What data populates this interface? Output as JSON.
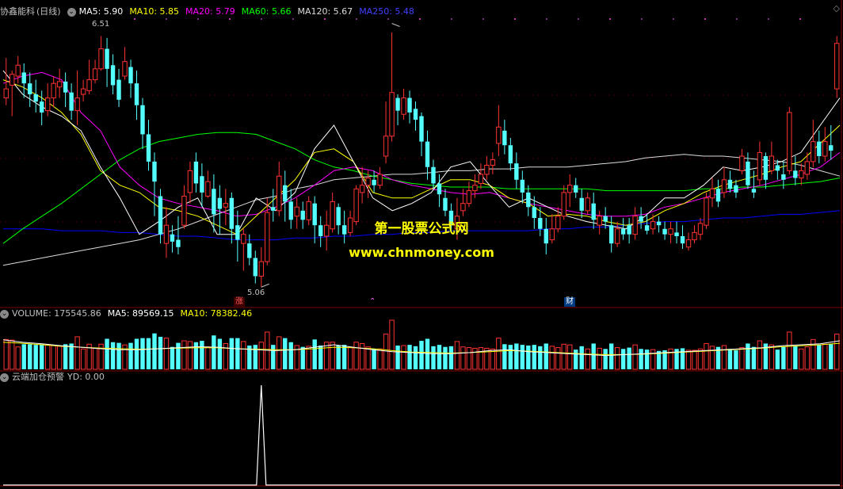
{
  "legend_main": {
    "name": "协鑫能科",
    "period": "(日线)",
    "ma5": "MA5: 5.90",
    "ma10": "MA10: 5.85",
    "ma20": "MA20: 5.79",
    "ma60": "MA60: 5.66",
    "ma120": "MA120: 5.67",
    "ma250": "MA250: 5.48"
  },
  "legend_vol": {
    "volume": "VOLUME: 175545.86",
    "ma5": "MA5: 89569.15",
    "ma10": "MA10: 78382.46"
  },
  "legend_ind": {
    "name": "云端加仓预警",
    "yd": "YD: 0.00"
  },
  "annotations": {
    "high": "6.51",
    "low": "5.06",
    "zhang": "涨",
    "cai": "财"
  },
  "watermark": {
    "line1": "第一股票公式网",
    "line2": "www.chnmoney.com"
  },
  "colors": {
    "up": "#ff3232",
    "down": "#54ffff",
    "ma5": "#ffffff",
    "ma10": "#ffff00",
    "ma20": "#ff00ff",
    "ma60": "#00ff00",
    "ma120": "#dcdcdc",
    "ma250": "#0000ff",
    "signal": "#ffffff",
    "grid": "#7f0000"
  },
  "chart_data": {
    "type": "candlestick",
    "price_range": [
      5.0,
      6.56
    ],
    "high_point": 6.51,
    "low_point": 5.06,
    "candles": [
      [
        6.1,
        6.15,
        6.06,
        6.32
      ],
      [
        6.17,
        6.23,
        6.0,
        6.25
      ],
      [
        6.22,
        6.28,
        6.18,
        6.33
      ],
      [
        6.24,
        6.18,
        6.1,
        6.29
      ],
      [
        6.18,
        6.12,
        6.05,
        6.24
      ],
      [
        6.12,
        6.08,
        6.02,
        6.2
      ],
      [
        6.08,
        6.02,
        5.95,
        6.14
      ],
      [
        6.03,
        6.1,
        6.0,
        6.18
      ],
      [
        6.1,
        6.18,
        6.05,
        6.22
      ],
      [
        6.16,
        6.19,
        6.1,
        6.26
      ],
      [
        6.19,
        6.13,
        6.05,
        6.24
      ],
      [
        6.13,
        6.03,
        5.98,
        6.18
      ],
      [
        6.03,
        6.1,
        5.95,
        6.25
      ],
      [
        6.12,
        6.15,
        6.08,
        6.2
      ],
      [
        6.14,
        6.2,
        6.12,
        6.31
      ],
      [
        6.2,
        6.26,
        6.18,
        6.31
      ],
      [
        6.26,
        6.37,
        6.25,
        6.44
      ],
      [
        6.37,
        6.26,
        6.16,
        6.43
      ],
      [
        6.28,
        6.17,
        6.12,
        6.34
      ],
      [
        6.2,
        6.09,
        6.05,
        6.26
      ],
      [
        6.22,
        6.3,
        6.2,
        6.38
      ],
      [
        6.27,
        6.18,
        6.1,
        6.31
      ],
      [
        6.18,
        6.06,
        5.98,
        6.25
      ],
      [
        6.06,
        5.9,
        5.82,
        6.1
      ],
      [
        5.9,
        5.75,
        5.7,
        5.98
      ],
      [
        5.75,
        5.64,
        5.45,
        5.8
      ],
      [
        5.56,
        5.35,
        5.3,
        5.6
      ],
      [
        5.3,
        5.4,
        5.22,
        5.5
      ],
      [
        5.35,
        5.31,
        5.25,
        5.4
      ],
      [
        5.32,
        5.28,
        5.24,
        5.45
      ],
      [
        5.4,
        5.56,
        5.38,
        5.62
      ],
      [
        5.58,
        5.7,
        5.52,
        5.75
      ],
      [
        5.75,
        5.63,
        5.58,
        5.8
      ],
      [
        5.67,
        5.58,
        5.5,
        5.74
      ],
      [
        5.56,
        5.64,
        5.55,
        5.7
      ],
      [
        5.6,
        5.46,
        5.36,
        5.68
      ],
      [
        5.55,
        5.49,
        5.35,
        5.62
      ],
      [
        5.5,
        5.52,
        5.4,
        5.6
      ],
      [
        5.55,
        5.38,
        5.3,
        5.58
      ],
      [
        5.4,
        5.32,
        5.2,
        5.48
      ],
      [
        5.3,
        5.35,
        5.15,
        5.38
      ],
      [
        5.3,
        5.22,
        5.18,
        5.35
      ],
      [
        5.22,
        5.12,
        5.08,
        5.26
      ],
      [
        5.12,
        5.2,
        5.06,
        5.28
      ],
      [
        5.2,
        5.47,
        5.18,
        5.55
      ],
      [
        5.5,
        5.48,
        5.42,
        5.6
      ],
      [
        5.48,
        5.67,
        5.45,
        5.75
      ],
      [
        5.62,
        5.53,
        5.42,
        5.7
      ],
      [
        5.53,
        5.43,
        5.38,
        5.6
      ],
      [
        5.45,
        5.5,
        5.38,
        5.55
      ],
      [
        5.48,
        5.43,
        5.38,
        5.53
      ],
      [
        5.43,
        5.53,
        5.4,
        5.56
      ],
      [
        5.52,
        5.4,
        5.3,
        5.56
      ],
      [
        5.4,
        5.34,
        5.28,
        5.45
      ],
      [
        5.34,
        5.4,
        5.26,
        5.48
      ],
      [
        5.38,
        5.53,
        5.36,
        5.58
      ],
      [
        5.5,
        5.4,
        5.35,
        5.52
      ],
      [
        5.4,
        5.35,
        5.3,
        5.48
      ],
      [
        5.36,
        5.44,
        5.34,
        5.48
      ],
      [
        5.42,
        5.6,
        5.4,
        5.62
      ],
      [
        5.58,
        5.62,
        5.52,
        5.72
      ],
      [
        5.62,
        5.66,
        5.55,
        5.7
      ],
      [
        5.65,
        5.62,
        5.58,
        5.7
      ],
      [
        5.62,
        5.68,
        5.6,
        5.72
      ],
      [
        5.78,
        5.89,
        5.74,
        6.08
      ],
      [
        5.89,
        6.13,
        5.86,
        6.46
      ],
      [
        6.1,
        6.03,
        5.95,
        6.12
      ],
      [
        6.01,
        6.1,
        5.98,
        6.15
      ],
      [
        6.1,
        6.02,
        5.96,
        6.14
      ],
      [
        6.04,
        5.98,
        5.92,
        6.08
      ],
      [
        6.0,
        5.86,
        5.78,
        6.02
      ],
      [
        5.86,
        5.72,
        5.65,
        5.92
      ],
      [
        5.72,
        5.63,
        5.6,
        5.76
      ],
      [
        5.63,
        5.57,
        5.5,
        5.68
      ],
      [
        5.55,
        5.48,
        5.45,
        5.6
      ],
      [
        5.48,
        5.4,
        5.36,
        5.52
      ],
      [
        5.38,
        5.45,
        5.32,
        5.55
      ],
      [
        5.48,
        5.52,
        5.45,
        5.6
      ],
      [
        5.52,
        5.59,
        5.5,
        5.64
      ],
      [
        5.59,
        5.62,
        5.55,
        5.68
      ],
      [
        5.63,
        5.68,
        5.6,
        5.74
      ],
      [
        5.68,
        5.73,
        5.65,
        5.78
      ],
      [
        5.73,
        5.76,
        5.68,
        5.8
      ],
      [
        5.85,
        5.94,
        5.78,
        6.06
      ],
      [
        5.92,
        5.84,
        5.79,
        5.98
      ],
      [
        5.84,
        5.74,
        5.7,
        5.88
      ],
      [
        5.74,
        5.65,
        5.6,
        5.8
      ],
      [
        5.65,
        5.58,
        5.52,
        5.7
      ],
      [
        5.58,
        5.5,
        5.45,
        5.62
      ],
      [
        5.5,
        5.44,
        5.38,
        5.56
      ],
      [
        5.44,
        5.38,
        5.34,
        5.5
      ],
      [
        5.38,
        5.3,
        5.24,
        5.44
      ],
      [
        5.32,
        5.38,
        5.3,
        5.46
      ],
      [
        5.38,
        5.45,
        5.36,
        5.5
      ],
      [
        5.45,
        5.58,
        5.43,
        5.62
      ],
      [
        5.58,
        5.62,
        5.5,
        5.68
      ],
      [
        5.62,
        5.58,
        5.55,
        5.66
      ],
      [
        5.55,
        5.48,
        5.44,
        5.6
      ],
      [
        5.48,
        5.55,
        5.46,
        5.58
      ],
      [
        5.52,
        5.43,
        5.38,
        5.58
      ],
      [
        5.4,
        5.45,
        5.35,
        5.48
      ],
      [
        5.45,
        5.42,
        5.38,
        5.5
      ],
      [
        5.4,
        5.3,
        5.25,
        5.45
      ],
      [
        5.3,
        5.38,
        5.28,
        5.42
      ],
      [
        5.38,
        5.35,
        5.32,
        5.44
      ],
      [
        5.4,
        5.35,
        5.3,
        5.44
      ],
      [
        5.35,
        5.45,
        5.32,
        5.5
      ],
      [
        5.45,
        5.42,
        5.38,
        5.5
      ],
      [
        5.4,
        5.37,
        5.35,
        5.46
      ],
      [
        5.38,
        5.42,
        5.35,
        5.46
      ],
      [
        5.42,
        5.4,
        5.36,
        5.45
      ],
      [
        5.38,
        5.35,
        5.32,
        5.42
      ],
      [
        5.35,
        5.38,
        5.3,
        5.42
      ],
      [
        5.36,
        5.34,
        5.3,
        5.42
      ],
      [
        5.34,
        5.3,
        5.27,
        5.4
      ],
      [
        5.28,
        5.32,
        5.26,
        5.36
      ],
      [
        5.32,
        5.36,
        5.3,
        5.4
      ],
      [
        5.35,
        5.41,
        5.32,
        5.44
      ],
      [
        5.4,
        5.55,
        5.38,
        5.58
      ],
      [
        5.55,
        5.6,
        5.5,
        5.66
      ],
      [
        5.6,
        5.53,
        5.5,
        5.65
      ],
      [
        5.58,
        5.65,
        5.55,
        5.72
      ],
      [
        5.65,
        5.6,
        5.58,
        5.7
      ],
      [
        5.62,
        5.58,
        5.55,
        5.65
      ],
      [
        5.7,
        5.78,
        5.68,
        5.82
      ],
      [
        5.75,
        5.62,
        5.6,
        5.8
      ],
      [
        5.6,
        5.58,
        5.55,
        5.7
      ],
      [
        5.65,
        5.8,
        5.62,
        5.86
      ],
      [
        5.78,
        5.65,
        5.6,
        5.8
      ],
      [
        5.7,
        5.78,
        5.68,
        5.86
      ],
      [
        5.73,
        5.7,
        5.65,
        5.76
      ],
      [
        5.68,
        5.65,
        5.6,
        5.75
      ],
      [
        5.7,
        6.02,
        5.68,
        6.05
      ],
      [
        5.7,
        5.66,
        5.62,
        5.78
      ],
      [
        5.66,
        5.7,
        5.62,
        5.74
      ],
      [
        5.68,
        5.75,
        5.65,
        5.8
      ],
      [
        5.75,
        5.86,
        5.72,
        5.98
      ],
      [
        5.86,
        5.78,
        5.74,
        5.92
      ],
      [
        5.78,
        5.86,
        5.75,
        5.94
      ],
      [
        5.84,
        5.81,
        5.76,
        5.95
      ],
      [
        6.15,
        6.4,
        6.1,
        6.44
      ]
    ],
    "ma5": [
      6.25,
      6.12,
      6.05,
      6.0,
      5.92,
      5.72,
      5.55,
      5.35,
      5.42,
      5.5,
      5.55,
      5.35,
      5.35,
      5.55,
      5.48,
      5.58,
      5.82,
      5.95,
      5.75,
      5.55,
      5.48,
      5.52,
      5.58,
      5.72,
      5.75,
      5.62,
      5.5,
      5.55,
      5.5,
      5.45,
      5.42,
      5.4,
      5.38,
      5.45,
      5.55,
      5.55,
      5.62,
      5.72,
      5.7,
      5.72,
      5.75,
      5.8,
      5.95,
      6.1
    ],
    "ma10": [
      6.2,
      6.16,
      6.1,
      6.02,
      5.9,
      5.7,
      5.62,
      5.58,
      5.5,
      5.48,
      5.45,
      5.4,
      5.35,
      5.45,
      5.55,
      5.65,
      5.8,
      5.82,
      5.75,
      5.58,
      5.55,
      5.55,
      5.6,
      5.65,
      5.65,
      5.62,
      5.55,
      5.52,
      5.45,
      5.46,
      5.45,
      5.42,
      5.4,
      5.42,
      5.48,
      5.52,
      5.58,
      5.62,
      5.65,
      5.68,
      5.72,
      5.75,
      5.85,
      5.95
    ],
    "ma20": [
      6.18,
      6.22,
      6.24,
      6.2,
      6.02,
      5.92,
      5.72,
      5.62,
      5.55,
      5.52,
      5.5,
      5.48,
      5.45,
      5.46,
      5.5,
      5.55,
      5.62,
      5.7,
      5.72,
      5.7,
      5.65,
      5.62,
      5.6,
      5.58,
      5.57,
      5.58,
      5.55,
      5.52,
      5.5,
      5.48,
      5.46,
      5.45,
      5.45,
      5.46,
      5.5,
      5.52,
      5.55,
      5.58,
      5.6,
      5.62,
      5.65,
      5.68,
      5.72,
      5.8
    ],
    "ma60": [
      5.3,
      5.38,
      5.45,
      5.52,
      5.6,
      5.68,
      5.76,
      5.82,
      5.86,
      5.88,
      5.9,
      5.91,
      5.91,
      5.9,
      5.86,
      5.82,
      5.76,
      5.72,
      5.7,
      5.67,
      5.65,
      5.63,
      5.62,
      5.61,
      5.61,
      5.61,
      5.6,
      5.6,
      5.6,
      5.6,
      5.6,
      5.59,
      5.59,
      5.59,
      5.59,
      5.59,
      5.6,
      5.6,
      5.61,
      5.61,
      5.62,
      5.63,
      5.64,
      5.66
    ],
    "ma120": [
      5.18,
      5.2,
      5.22,
      5.24,
      5.26,
      5.28,
      5.3,
      5.32,
      5.35,
      5.38,
      5.42,
      5.46,
      5.5,
      5.54,
      5.56,
      5.6,
      5.62,
      5.65,
      5.66,
      5.67,
      5.68,
      5.68,
      5.69,
      5.7,
      5.7,
      5.71,
      5.71,
      5.72,
      5.72,
      5.72,
      5.73,
      5.74,
      5.75,
      5.77,
      5.78,
      5.79,
      5.78,
      5.78,
      5.77,
      5.76,
      5.75,
      5.73,
      5.7,
      5.67
    ],
    "ma250": [
      5.38,
      5.38,
      5.38,
      5.37,
      5.37,
      5.37,
      5.36,
      5.36,
      5.35,
      5.34,
      5.34,
      5.33,
      5.32,
      5.32,
      5.32,
      5.33,
      5.33,
      5.34,
      5.34,
      5.35,
      5.35,
      5.36,
      5.36,
      5.37,
      5.37,
      5.37,
      5.37,
      5.37,
      5.38,
      5.38,
      5.39,
      5.39,
      5.4,
      5.41,
      5.42,
      5.42,
      5.43,
      5.44,
      5.44,
      5.45,
      5.46,
      5.46,
      5.47,
      5.48
    ],
    "volume_ma5": [
      0.6,
      0.55,
      0.52,
      0.48,
      0.45,
      0.42,
      0.4,
      0.4,
      0.42,
      0.44,
      0.46,
      0.45,
      0.42,
      0.4,
      0.38,
      0.4,
      0.45,
      0.5,
      0.45,
      0.4,
      0.36,
      0.34,
      0.32,
      0.32,
      0.34,
      0.38,
      0.4,
      0.36,
      0.34,
      0.32,
      0.3,
      0.28,
      0.3,
      0.32,
      0.34,
      0.36,
      0.38,
      0.4,
      0.42,
      0.44,
      0.48,
      0.5,
      0.52,
      0.58
    ],
    "volume_ma10": [
      0.55,
      0.53,
      0.5,
      0.47,
      0.45,
      0.43,
      0.42,
      0.41,
      0.42,
      0.43,
      0.44,
      0.44,
      0.42,
      0.41,
      0.4,
      0.4,
      0.42,
      0.45,
      0.44,
      0.42,
      0.38,
      0.35,
      0.34,
      0.33,
      0.34,
      0.36,
      0.38,
      0.37,
      0.35,
      0.33,
      0.31,
      0.3,
      0.3,
      0.31,
      0.33,
      0.35,
      0.37,
      0.39,
      0.41,
      0.43,
      0.46,
      0.48,
      0.5,
      0.53
    ],
    "signal_spike_index": 43
  }
}
